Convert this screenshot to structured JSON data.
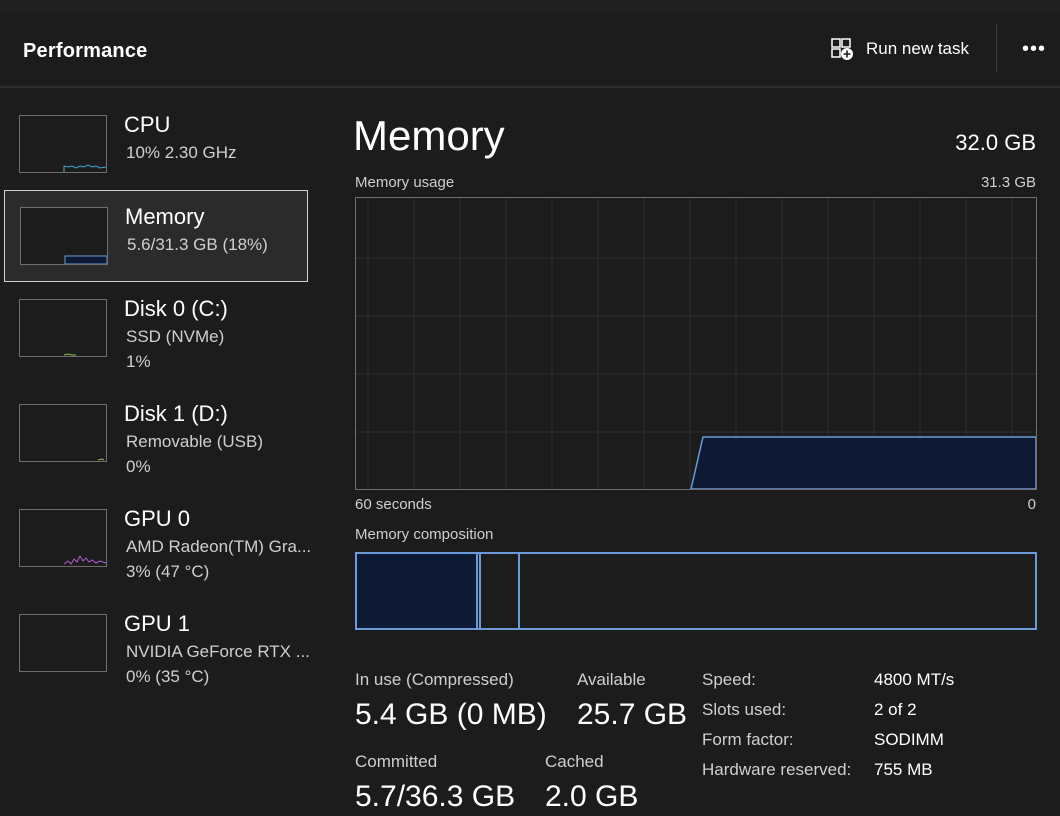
{
  "header": {
    "title": "Performance",
    "run_new_task_label": "Run new task",
    "run_new_task_icon": "run-task-icon",
    "more_icon": "more-options-icon",
    "more_glyph": "•••"
  },
  "sidebar": {
    "items": [
      {
        "title": "CPU",
        "line1": "10%  2.30 GHz",
        "line2": "",
        "graph_color": "#3ea8d8",
        "utilization_percent": 10
      },
      {
        "title": "Memory",
        "line1": "5.6/31.3 GB (18%)",
        "line2": "",
        "graph_color": "#6b9ad8",
        "utilization_percent": 18,
        "selected": true
      },
      {
        "title": "Disk 0 (C:)",
        "line1": "SSD (NVMe)",
        "line2": "1%",
        "graph_color": "#8bc34a",
        "utilization_percent": 1
      },
      {
        "title": "Disk 1 (D:)",
        "line1": "Removable (USB)",
        "line2": "0%",
        "graph_color": "#8bc34a",
        "utilization_percent": 0
      },
      {
        "title": "GPU 0",
        "line1": "AMD Radeon(TM) Gra...",
        "line2": "3%  (47 °C)",
        "graph_color": "#b45bd6",
        "utilization_percent": 3
      },
      {
        "title": "GPU 1",
        "line1": "NVIDIA GeForce RTX ...",
        "line2": "0%  (35 °C)",
        "graph_color": "#b45bd6",
        "utilization_percent": 0
      }
    ]
  },
  "main": {
    "title": "Memory",
    "total": "32.0 GB",
    "usage_label": "Memory usage",
    "usage_max": "31.3 GB",
    "time_left_label": "60 seconds",
    "time_right_label": "0",
    "composition_label": "Memory composition",
    "accent_color": "#6b9ad8",
    "fill_color": "#0e1a33",
    "stats": {
      "in_use_label": "In use (Compressed)",
      "in_use_value": "5.4 GB (0 MB)",
      "available_label": "Available",
      "available_value": "25.7 GB",
      "committed_label": "Committed",
      "committed_value": "5.7/36.3 GB",
      "cached_label": "Cached",
      "cached_value": "2.0 GB"
    },
    "details": [
      {
        "label": "Speed:",
        "value": "4800 MT/s"
      },
      {
        "label": "Slots used:",
        "value": "2 of 2"
      },
      {
        "label": "Form factor:",
        "value": "SODIMM"
      },
      {
        "label": "Hardware reserved:",
        "value": "755 MB"
      }
    ]
  }
}
